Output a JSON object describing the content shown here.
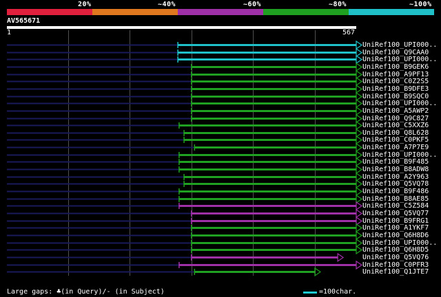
{
  "legend": {
    "labels": [
      "20%",
      "~40%",
      "~60%",
      "~80%",
      "~100%"
    ],
    "colors": [
      "#e0203c",
      "#e07820",
      "#a030a8",
      "#20a020",
      "#20c0c8"
    ]
  },
  "query": {
    "id": "AV565671",
    "start": "1",
    "end": "567",
    "length": 567
  },
  "hits": [
    {
      "label": "UniRef100_UPI000..",
      "color": "cyan",
      "start": 278,
      "end": 567
    },
    {
      "label": "UniRef100_Q9CAA0",
      "color": "cyan",
      "start": 278,
      "end": 567
    },
    {
      "label": "UniRef100_UPI000..",
      "color": "cyan",
      "start": 278,
      "end": 567
    },
    {
      "label": "UniRef100_B9GEK6",
      "color": "green",
      "start": 300,
      "end": 567
    },
    {
      "label": "UniRef100_A9PF13",
      "color": "green",
      "start": 300,
      "end": 567
    },
    {
      "label": "UniRef100_C0Z2S5",
      "color": "green",
      "start": 300,
      "end": 567
    },
    {
      "label": "UniRef100_B9DFE3",
      "color": "green",
      "start": 300,
      "end": 567
    },
    {
      "label": "UniRef100_B9SQC0",
      "color": "green",
      "start": 300,
      "end": 567
    },
    {
      "label": "UniRef100_UPI000..",
      "color": "green",
      "start": 300,
      "end": 567
    },
    {
      "label": "UniRef100_A5AWP2",
      "color": "green",
      "start": 300,
      "end": 567
    },
    {
      "label": "UniRef100_Q9C827",
      "color": "green",
      "start": 300,
      "end": 567
    },
    {
      "label": "UniRef100_C5XXZ6",
      "color": "green",
      "start": 280,
      "end": 567
    },
    {
      "label": "UniRef100_Q8L628",
      "color": "green",
      "start": 288,
      "end": 567
    },
    {
      "label": "UniRef100_C0PKF5",
      "color": "green",
      "start": 288,
      "end": 567
    },
    {
      "label": "UniRef100_A7P7E9",
      "color": "green",
      "start": 305,
      "end": 567
    },
    {
      "label": "UniRef100_UPI000..",
      "color": "green",
      "start": 280,
      "end": 567
    },
    {
      "label": "UniRef100_B9F485",
      "color": "green",
      "start": 280,
      "end": 567
    },
    {
      "label": "UniRef100_B8ADW8",
      "color": "green",
      "start": 280,
      "end": 567
    },
    {
      "label": "UniRef100_A2Y963",
      "color": "green",
      "start": 288,
      "end": 567
    },
    {
      "label": "UniRef100_Q5VQ78",
      "color": "green",
      "start": 288,
      "end": 567
    },
    {
      "label": "UniRef100_B9F486",
      "color": "green",
      "start": 280,
      "end": 567
    },
    {
      "label": "UniRef100_B8AE85",
      "color": "green",
      "start": 280,
      "end": 567
    },
    {
      "label": "UniRef100_C5Z584",
      "color": "magenta",
      "start": 280,
      "end": 567
    },
    {
      "label": "UniRef100_Q5VQ77",
      "color": "magenta",
      "start": 300,
      "end": 567
    },
    {
      "label": "UniRef100_B9FRG1",
      "color": "magenta",
      "start": 300,
      "end": 567
    },
    {
      "label": "UniRef100_A1YKF7",
      "color": "green",
      "start": 300,
      "end": 567
    },
    {
      "label": "UniRef100_Q6H8D6",
      "color": "green",
      "start": 300,
      "end": 567
    },
    {
      "label": "UniRef100_UPI000..",
      "color": "green",
      "start": 300,
      "end": 567
    },
    {
      "label": "UniRef100_Q6H8D5",
      "color": "green",
      "start": 300,
      "end": 567
    },
    {
      "label": "UniRef100_Q5VQ76",
      "color": "magenta",
      "start": 300,
      "end": 537
    },
    {
      "label": "UniRef100_C0PFR3",
      "color": "magenta",
      "start": 280,
      "end": 567
    },
    {
      "label": "UniRef100_Q1JTE7",
      "color": "green",
      "start": 305,
      "end": 500
    }
  ],
  "footer": {
    "gaps_text": "Large gaps: ♣(in Query)/- (in Subject)",
    "scale_text": "=100char."
  },
  "palette": {
    "cyan": "#20c0c8",
    "green": "#20a020",
    "magenta": "#a030a8",
    "grid": "#505050",
    "left_line": "#1a1a5a"
  }
}
